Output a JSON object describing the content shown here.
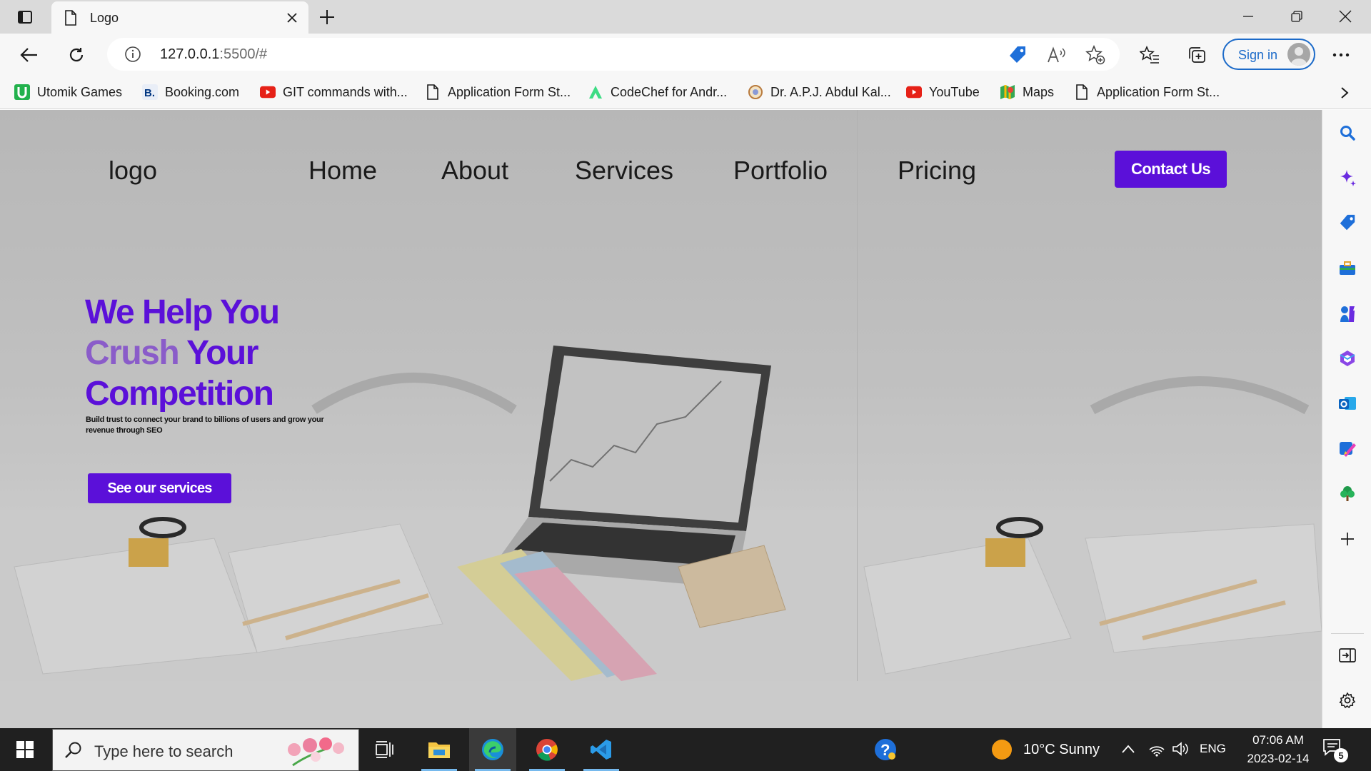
{
  "browser": {
    "tab": {
      "title": "Logo"
    },
    "address": {
      "host": "127.0.0.1",
      "rest": ":5500/#"
    },
    "signin_label": "Sign in",
    "favorites": [
      {
        "label": "Utomik Games",
        "icon": "utomik-icon"
      },
      {
        "label": "Booking.com",
        "icon": "booking-icon"
      },
      {
        "label": "GIT commands with...",
        "icon": "youtube-icon"
      },
      {
        "label": "Application Form St...",
        "icon": "page-icon"
      },
      {
        "label": "CodeChef for Andr...",
        "icon": "android-icon"
      },
      {
        "label": "Dr. A.P.J. Abdul Kal...",
        "icon": "emblem-icon"
      },
      {
        "label": "YouTube",
        "icon": "youtube-icon"
      },
      {
        "label": "Maps",
        "icon": "maps-icon"
      },
      {
        "label": "Application Form St...",
        "icon": "page-icon"
      }
    ]
  },
  "site": {
    "logo": "logo",
    "nav": [
      "Home",
      "About",
      "Services",
      "Portfolio",
      "Pricing"
    ],
    "contact": "Contact Us",
    "headline_line1": "We Help You",
    "headline_crush": "Crush",
    "headline_your": "Your",
    "headline_line3": "Competition",
    "subtext": "Build trust to connect your brand to billions of users and grow your revenue through SEO",
    "cta": "See our services",
    "colors": {
      "accent": "#5b10d9",
      "accent_light": "#8a5cc9"
    }
  },
  "taskbar": {
    "search_placeholder": "Type here to search",
    "weather": "10°C  Sunny",
    "language": "ENG",
    "time": "07:06 AM",
    "date": "2023-02-14",
    "notification_count": "5"
  }
}
